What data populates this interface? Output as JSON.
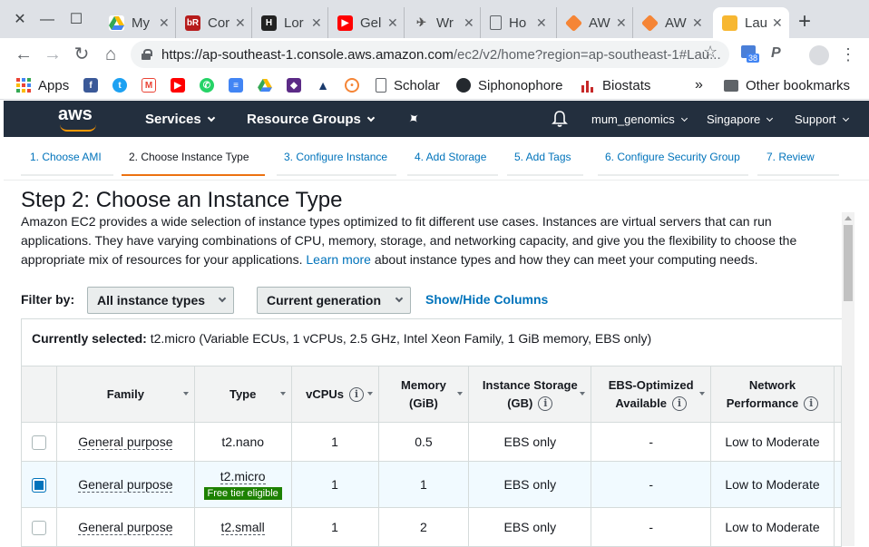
{
  "browser": {
    "tabs": [
      {
        "title": "My",
        "icon": "google-drive-icon",
        "color": "#34a853"
      },
      {
        "title": "Cor",
        "icon": "br-icon",
        "color": "#b71c1c"
      },
      {
        "title": "Lor",
        "icon": "h-icon",
        "color": "#222222"
      },
      {
        "title": "Gel",
        "icon": "youtube-icon",
        "color": "#ff0000"
      },
      {
        "title": "Wr",
        "icon": "ufo-icon",
        "color": "#555555"
      },
      {
        "title": "Ho",
        "icon": "document-icon",
        "color": "#5f6368"
      },
      {
        "title": "AW",
        "icon": "aws-cube-icon",
        "color": "#f58536"
      },
      {
        "title": "AW",
        "icon": "aws-cube-icon",
        "color": "#f58536"
      },
      {
        "title": "Lau",
        "icon": "aws-box-icon",
        "color": "#f7b731"
      }
    ],
    "url_main": "https://ap-southeast-1.console.aws.amazon.com",
    "url_rest": "/ec2/v2/home?region=ap-southeast-1#Lau...",
    "bookmarks": {
      "apps": "Apps",
      "scholar": "Scholar",
      "siphonophore": "Siphonophore",
      "biostats": "Biostats",
      "more": "»",
      "other": "Other bookmarks"
    },
    "ext_badge": "38"
  },
  "aws": {
    "logo": "aws",
    "services": "Services",
    "resource_groups": "Resource Groups",
    "user": "mum_genomics",
    "region": "Singapore",
    "support": "Support"
  },
  "steps": [
    "1. Choose AMI",
    "2. Choose Instance Type",
    "3. Configure Instance",
    "4. Add Storage",
    "5. Add Tags",
    "6. Configure Security Group",
    "7. Review"
  ],
  "page": {
    "title": "Step 2: Choose an Instance Type",
    "desc1": "Amazon EC2 provides a wide selection of instance types optimized to fit different use cases. Instances are virtual servers that can run",
    "desc2": "applications. They have varying combinations of CPU, memory, storage, and networking capacity, and give you the flexibility to choose the",
    "desc3": "appropriate mix of resources for your applications.",
    "learn_more": "Learn more",
    "desc4": "about instance types and how they can meet your computing needs.",
    "filter_label": "Filter by:",
    "filter1": "All instance types",
    "filter2": "Current generation",
    "show_hide": "Show/Hide Columns",
    "currently_label": "Currently selected:",
    "currently_value": "t2.micro (Variable ECUs, 1 vCPUs, 2.5 GHz, Intel Xeon Family, 1 GiB memory, EBS only)"
  },
  "table": {
    "headers": {
      "family": "Family",
      "type": "Type",
      "vcpus": "vCPUs",
      "memory1": "Memory",
      "memory2": "(GiB)",
      "storage1": "Instance Storage",
      "storage2": "(GB)",
      "ebs1": "EBS-Optimized",
      "ebs2": "Available",
      "net1": "Network",
      "net2": "Performance"
    },
    "rows": [
      {
        "family": "General purpose",
        "type": "t2.nano",
        "vcpus": "1",
        "memory": "0.5",
        "storage": "EBS only",
        "ebs": "-",
        "network": "Low to Moderate",
        "checked": false
      },
      {
        "family": "General purpose",
        "type": "t2.micro",
        "badge": "Free tier eligible",
        "vcpus": "1",
        "memory": "1",
        "storage": "EBS only",
        "ebs": "-",
        "network": "Low to Moderate",
        "checked": true
      },
      {
        "family": "General purpose",
        "type": "t2.small",
        "vcpus": "1",
        "memory": "2",
        "storage": "EBS only",
        "ebs": "-",
        "network": "Low to Moderate",
        "checked": false
      }
    ]
  }
}
